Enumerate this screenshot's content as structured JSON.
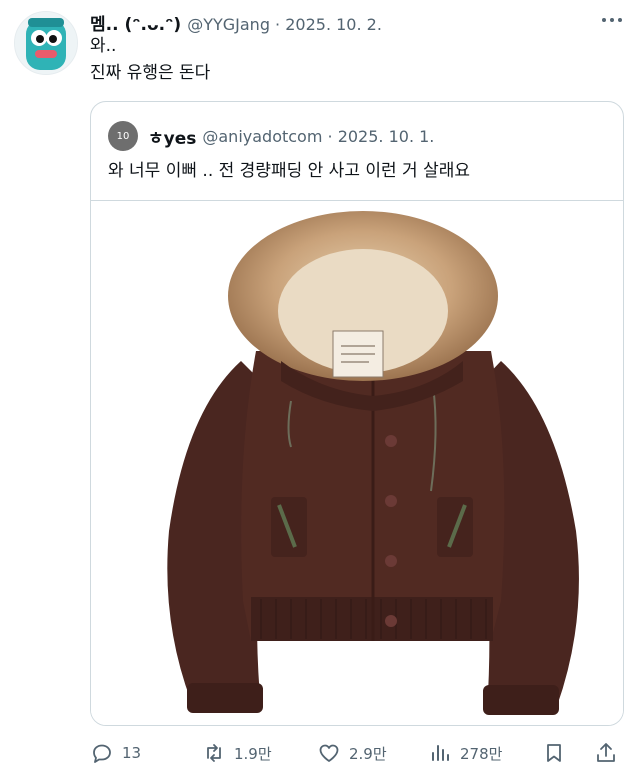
{
  "tweet": {
    "author_name": "멤.. (ᵔ.ᴗ.ᵔ)",
    "author_meta": "@YYGJang · 2025. 10. 2.",
    "lines": [
      "와..",
      "진짜 유행은 돈다"
    ]
  },
  "quote": {
    "avatar_text": "10",
    "author_name": "ㅎyes",
    "author_meta": "@aniyadotcom · 2025. 10. 1.",
    "text": "와 너무 이뻐 .. 전 경량패딩 안 사고 이런 거 살래요"
  },
  "actions": {
    "replies": "13",
    "retweets": "1.9만",
    "likes": "2.9만",
    "views": "278만"
  },
  "colors": {
    "secondary_text": "#536471",
    "border": "#cfd9de",
    "jacket_brown": "#4a2620",
    "fur": "#c9a27a"
  },
  "icons": [
    "reply-icon",
    "retweet-icon",
    "like-icon",
    "views-icon",
    "bookmark-icon",
    "share-icon",
    "more-icon"
  ]
}
